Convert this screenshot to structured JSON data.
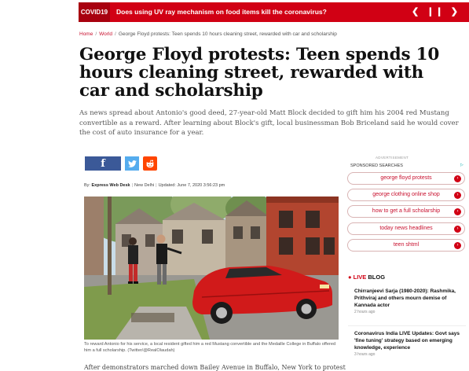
{
  "ticker": {
    "tag": "COVID19",
    "headline": "Does using UV ray mechanism on food items kill the coronavirus?",
    "prev": "❮",
    "pause": "❙❙",
    "next": "❯"
  },
  "breadcrumb": {
    "home": "Home",
    "section": "World",
    "current": "George Floyd protests: Teen spends 10 hours cleaning street, rewarded with car and scholarship"
  },
  "article": {
    "title": "George Floyd protests: Teen spends 10 hours cleaning street, rewarded with car and scholarship",
    "summary": "As news spread about Antonio's good deed, 27-year-old Matt Block decided to gift him his 2004 red Mustang convertible as a reward. After learning about Block's gift, local businessman Bob Briceland said he would cover the cost of auto insurance for a year.",
    "by_label": "By:",
    "author": "Express Web Desk",
    "location": "New Delhi",
    "updated": "Updated: June 7, 2020 3:56:23 pm",
    "caption": "To reward Antonio for his service, a local resident gifted him a red Mustang convertible and the Medaille College in Buffalo offered him a full scholarship. (Twitter/@RealOlaudah)",
    "body_start": "After demonstrators marched down Bailey Avenue in Buffalo, New York to protest"
  },
  "share": {
    "facebook_icon": "f",
    "twitter_icon": "🐦",
    "reddit_icon": "●"
  },
  "sidebar": {
    "ad_label": "ADVERTISEMENT",
    "sponsored_label": "SPONSORED SEARCHES",
    "adchoices": "▷",
    "searches": [
      "george floyd protests",
      "george clothing online shop",
      "how to get a full scholarship",
      "today news headlines",
      "teen shtml"
    ],
    "live": {
      "dot": "●",
      "live_label": "LIVE",
      "blog_label": "BLOG",
      "items": [
        {
          "title": "Chirranjeevi Sarja (1980-2020): Rashmika, Prithviraj and others mourn demise of Kannada actor",
          "ago": "2 hours ago"
        },
        {
          "title": "Coronavirus India LIVE Updates: Govt says 'fine tuning' strategy based on emerging knowledge, experience",
          "ago": "3 hours ago"
        }
      ]
    }
  },
  "colors": {
    "brand_red": "#d10014",
    "facebook": "#3b5998",
    "twitter": "#55acee",
    "reddit": "#ff4500",
    "car_red": "#d11a1a"
  }
}
